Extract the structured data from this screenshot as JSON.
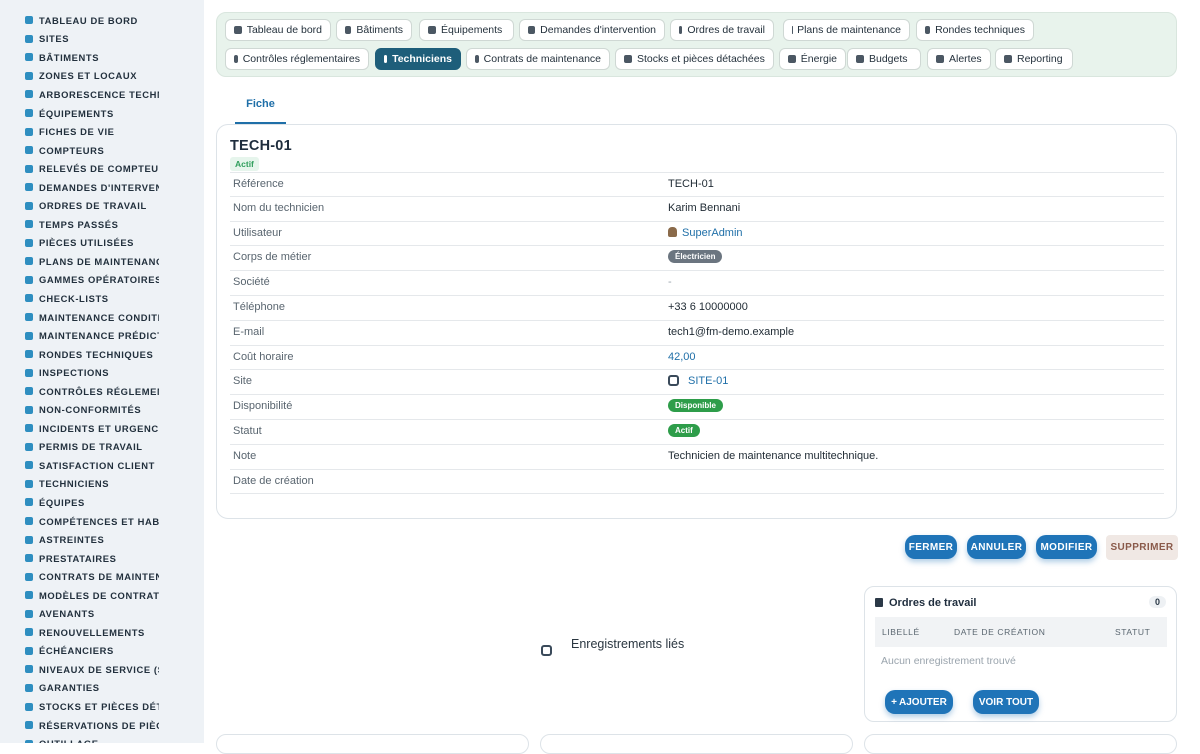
{
  "sidebar": {
    "items": [
      {
        "label": "TABLEAU DE BORD",
        "icon": "dashboard-icon"
      },
      {
        "label": "SITES",
        "icon": "map-pin-icon"
      },
      {
        "label": "BÂTIMENTS",
        "icon": "building-icon"
      },
      {
        "label": "ZONES ET LOCAUX",
        "icon": "zones-icon"
      },
      {
        "label": "ARBORESCENCE TECHNI",
        "icon": "tree-icon"
      },
      {
        "label": "ÉQUIPEMENTS",
        "icon": "gears-icon"
      },
      {
        "label": "FICHES DE VIE",
        "icon": "history-icon"
      },
      {
        "label": "COMPTEURS",
        "icon": "gauge-icon"
      },
      {
        "label": "RELEVÉS DE COMPTEURS",
        "icon": "readings-icon"
      },
      {
        "label": "DEMANDES D'INTERVENT",
        "icon": "request-icon"
      },
      {
        "label": "ORDRES DE TRAVAIL",
        "icon": "clipboard-icon"
      },
      {
        "label": "TEMPS PASSÉS",
        "icon": "clock-icon"
      },
      {
        "label": "PIÈCES UTILISÉES",
        "icon": "parts-icon"
      },
      {
        "label": "PLANS DE MAINTENANCE",
        "icon": "calendar-icon"
      },
      {
        "label": "GAMMES OPÉRATOIRES",
        "icon": "list-icon"
      },
      {
        "label": "CHECK-LISTS",
        "icon": "checklist-icon"
      },
      {
        "label": "MAINTENANCE CONDITIO",
        "icon": "thermometer-icon"
      },
      {
        "label": "MAINTENANCE PRÉDICTI",
        "icon": "chart-icon"
      },
      {
        "label": "RONDES TECHNIQUES",
        "icon": "route-icon"
      },
      {
        "label": "INSPECTIONS",
        "icon": "magnifier-icon"
      },
      {
        "label": "CONTRÔLES RÉGLEMENT",
        "icon": "check-doc-icon"
      },
      {
        "label": "NON-CONFORMITÉS",
        "icon": "warning-circle-icon"
      },
      {
        "label": "INCIDENTS ET URGENCES",
        "icon": "triangle-alert-icon"
      },
      {
        "label": "PERMIS DE TRAVAIL",
        "icon": "permit-icon"
      },
      {
        "label": "SATISFACTION CLIENT",
        "icon": "smile-icon"
      },
      {
        "label": "TECHNICIENS",
        "icon": "hardhat-icon"
      },
      {
        "label": "ÉQUIPES",
        "icon": "team-icon"
      },
      {
        "label": "COMPÉTENCES ET HABIL",
        "icon": "badge-icon"
      },
      {
        "label": "ASTREINTES",
        "icon": "phone-icon"
      },
      {
        "label": "PRESTATAIRES",
        "icon": "handshake-icon"
      },
      {
        "label": "CONTRATS DE MAINTENA",
        "icon": "contract-icon"
      },
      {
        "label": "MODÈLES DE CONTRATS",
        "icon": "template-icon"
      },
      {
        "label": "AVENANTS",
        "icon": "amendment-icon"
      },
      {
        "label": "RENOUVELLEMENTS",
        "icon": "refresh-icon"
      },
      {
        "label": "ÉCHÉANCIERS",
        "icon": "schedule-icon"
      },
      {
        "label": "NIVEAUX DE SERVICE (SL",
        "icon": "sla-icon"
      },
      {
        "label": "GARANTIES",
        "icon": "shield-icon"
      },
      {
        "label": "STOCKS ET PIÈCES DÉTA",
        "icon": "boxes-icon"
      },
      {
        "label": "RÉSERVATIONS DE PIÈCE",
        "icon": "reservation-icon"
      },
      {
        "label": "OUTILLAGE",
        "icon": "tools-icon"
      }
    ]
  },
  "tabs": {
    "row1": [
      {
        "label": "Tableau de bord",
        "icon": "dashboard-icon"
      },
      {
        "label": "Bâtiments",
        "icon": "building-icon"
      },
      {
        "label": "Équipements",
        "icon": "gears-icon"
      },
      {
        "label": "Demandes d'intervention",
        "icon": "request-icon"
      },
      {
        "label": "Ordres de travail",
        "icon": "clipboard-icon"
      },
      {
        "label": "Plans de maintenance",
        "icon": "calendar-icon"
      },
      {
        "label": "Rondes techniques",
        "icon": "route-icon"
      }
    ],
    "row2": [
      {
        "label": "Contrôles réglementaires",
        "icon": "check-doc-icon"
      },
      {
        "label": "Techniciens",
        "icon": "hardhat-icon",
        "active": true
      },
      {
        "label": "Contrats de maintenance",
        "icon": "contract-icon"
      },
      {
        "label": "Stocks et pièces détachées",
        "icon": "boxes-icon"
      },
      {
        "label": "Énergie",
        "icon": "bolt-icon"
      },
      {
        "label": "Budgets",
        "icon": "money-icon"
      },
      {
        "label": "Alertes",
        "icon": "bell-icon"
      },
      {
        "label": "Reporting",
        "icon": "pie-icon"
      }
    ]
  },
  "subtabs": {
    "fiche": "Fiche"
  },
  "record": {
    "title": "TECH-01",
    "status_badge": "Actif",
    "fields": [
      {
        "key": "Référence",
        "value": "TECH-01",
        "type": "text"
      },
      {
        "key": "Nom du technicien",
        "value": "Karim Bennani",
        "type": "text"
      },
      {
        "key": "Utilisateur",
        "value": "SuperAdmin",
        "type": "user-link"
      },
      {
        "key": "Corps de métier",
        "value": "Électricien",
        "type": "pill-grey"
      },
      {
        "key": "Société",
        "value": "-",
        "type": "muted"
      },
      {
        "key": "Téléphone",
        "value": "+33 6 10000000",
        "type": "text"
      },
      {
        "key": "E-mail",
        "value": "tech1@fm-demo.example",
        "type": "text"
      },
      {
        "key": "Coût horaire",
        "value": "42,00",
        "type": "link"
      },
      {
        "key": "Site",
        "value": "SITE-01",
        "type": "site-link"
      },
      {
        "key": "Disponibilité",
        "value": "Disponible",
        "type": "pill-green"
      },
      {
        "key": "Statut",
        "value": "Actif",
        "type": "pill-green"
      },
      {
        "key": "Note",
        "value": "Technicien de maintenance multitechnique.",
        "type": "text"
      },
      {
        "key": "Date de création",
        "value": "",
        "type": "text"
      }
    ]
  },
  "actions": {
    "close": "FERMER",
    "cancel": "ANNULER",
    "edit": "MODIFIER",
    "delete": "SUPPRIMER"
  },
  "linked": {
    "label": "Enregistrements liés"
  },
  "work_orders_panel": {
    "title": "Ordres de travail",
    "count": "0",
    "columns": [
      "LIBELLÉ",
      "DATE DE CRÉATION",
      "STATUT"
    ],
    "empty": "Aucun enregistrement trouvé",
    "add": "AJOUTER",
    "view_all": "VOIR TOUT"
  },
  "colors": {
    "accent": "#1f74b8",
    "active_tab": "#1e5e7a",
    "success": "#2e9d4a"
  }
}
